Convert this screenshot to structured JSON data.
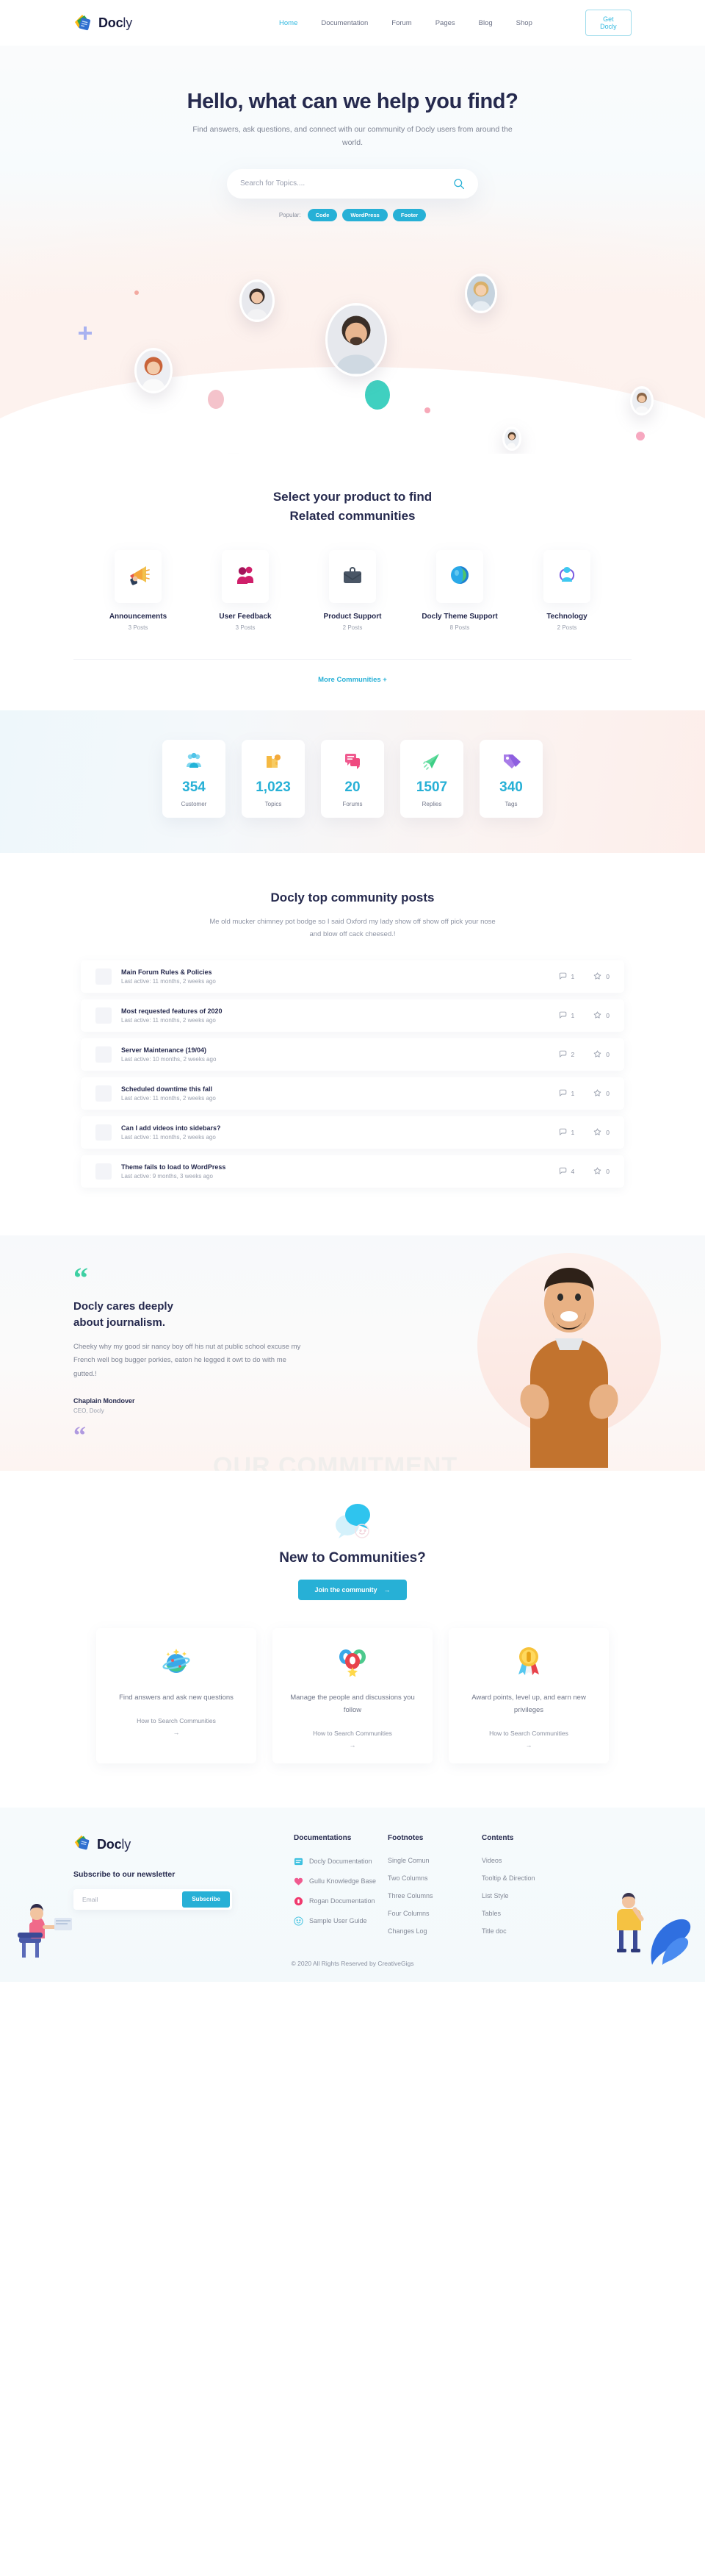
{
  "header": {
    "brand_bold": "Doc",
    "brand_light": "ly",
    "nav": [
      {
        "label": "Home",
        "active": true
      },
      {
        "label": "Documentation",
        "active": false
      },
      {
        "label": "Forum",
        "active": false
      },
      {
        "label": "Pages",
        "active": false
      },
      {
        "label": "Blog",
        "active": false
      },
      {
        "label": "Shop",
        "active": false
      }
    ],
    "cta_label": "Get Docly"
  },
  "hero": {
    "title": "Hello, what can we help you find?",
    "subtitle": "Find answers, ask questions, and connect with our community of Docly users from around the world.",
    "search_placeholder": "Search for Topics....",
    "search_value": "",
    "popular_label": "Popular:",
    "tags": [
      "Code",
      "WordPress",
      "Footer"
    ]
  },
  "products": {
    "title_line1": "Select your product to find",
    "title_line2": "Related communities",
    "items": [
      {
        "name": "Announcements",
        "posts": "3 Posts",
        "icon": "megaphone-icon"
      },
      {
        "name": "User Feedback",
        "posts": "3 Posts",
        "icon": "people-icon"
      },
      {
        "name": "Product Support",
        "posts": "2 Posts",
        "icon": "briefcase-icon"
      },
      {
        "name": "Docly Theme Support",
        "posts": "8 Posts",
        "icon": "globe-icon"
      },
      {
        "name": "Technology",
        "posts": "2 Posts",
        "icon": "network-icon"
      }
    ],
    "more_label": "More Communities  +"
  },
  "stats": [
    {
      "value": "354",
      "label": "Customer",
      "icon": "group-icon"
    },
    {
      "value": "1,023",
      "label": "Topics",
      "icon": "puzzle-icon"
    },
    {
      "value": "20",
      "label": "Forums",
      "icon": "chat-icon"
    },
    {
      "value": "1507",
      "label": "Replies",
      "icon": "paperplane-icon"
    },
    {
      "value": "340",
      "label": "Tags",
      "icon": "tag-icon"
    }
  ],
  "posts_section": {
    "title": "Docly top community posts",
    "subtitle": "Me old mucker chimney pot bodge so I said Oxford my lady show off show off pick your nose and blow off cack cheesed.!",
    "posts": [
      {
        "title": "Main Forum Rules & Policies",
        "meta": "Last active: 11 months, 2 weeks ago",
        "comments": "1",
        "stars": "0"
      },
      {
        "title": "Most requested features of 2020",
        "meta": "Last active: 11 months, 2 weeks ago",
        "comments": "1",
        "stars": "0"
      },
      {
        "title": "Server Maintenance (19/04)",
        "meta": "Last active: 10 months, 2 weeks ago",
        "comments": "2",
        "stars": "0"
      },
      {
        "title": "Scheduled downtime this fall",
        "meta": "Last active: 11 months, 2 weeks ago",
        "comments": "1",
        "stars": "0"
      },
      {
        "title": "Can I add videos into sidebars?",
        "meta": "Last active: 11 months, 2 weeks ago",
        "comments": "1",
        "stars": "0"
      },
      {
        "title": "Theme fails to load to WordPress",
        "meta": "Last active: 9 months, 3 weeks ago",
        "comments": "4",
        "stars": "0"
      }
    ]
  },
  "testimonial": {
    "heading_line1": "Docly cares deeply",
    "heading_line2": "about journalism.",
    "body": "Cheeky why my good sir nancy boy off his nut at public school excuse my French well bog bugger porkies, eaton he legged it owt to do with me gutted.!",
    "author": "Chaplain Mondover",
    "role": "CEO, Docly",
    "background_text": "OUR COMMITMENT",
    "quote_glyph": "“"
  },
  "newcom": {
    "title": "New to Communities?",
    "cta_label": "Join the community",
    "cta_arrow": "→",
    "features": [
      {
        "text": "Find answers and ask new questions",
        "link": "How to Search Communities",
        "arrow": "→",
        "icon": "planet-icon"
      },
      {
        "text": "Manage the people and discussions you follow",
        "link": "How to Search Communities",
        "arrow": "→",
        "icon": "balloons-icon"
      },
      {
        "text": "Award points, level up, and earn new privileges",
        "link": "How to Search Communities",
        "arrow": "→",
        "icon": "medal-icon"
      }
    ]
  },
  "footer": {
    "brand_bold": "Doc",
    "brand_light": "ly",
    "newsletter_title": "Subscribe to our newsletter",
    "email_placeholder": "Email",
    "email_value": "",
    "subscribe_label": "Subscribe",
    "columns": [
      {
        "title": "Documentations",
        "items": [
          {
            "label": "Docly Documentation",
            "icon": "docly-doc-icon"
          },
          {
            "label": "Gullu Knowledge Base",
            "icon": "gullu-icon"
          },
          {
            "label": "Rogan Documentation",
            "icon": "rogan-icon"
          },
          {
            "label": "Sample User Guide",
            "icon": "smiley-icon"
          }
        ]
      },
      {
        "title": "Footnotes",
        "items": [
          {
            "label": "Single Comun",
            "icon": ""
          },
          {
            "label": "Two Columns",
            "icon": ""
          },
          {
            "label": "Three Columns",
            "icon": ""
          },
          {
            "label": "Four Columns",
            "icon": ""
          },
          {
            "label": "Changes Log",
            "icon": ""
          }
        ]
      },
      {
        "title": "Contents",
        "items": [
          {
            "label": "Videos",
            "icon": ""
          },
          {
            "label": "Tooltip & Direction",
            "icon": ""
          },
          {
            "label": "List Style",
            "icon": ""
          },
          {
            "label": "Tables",
            "icon": ""
          },
          {
            "label": "Title doc",
            "icon": ""
          }
        ]
      }
    ],
    "copyright": "© 2020 All Rights Reserved by CreativeGigs"
  },
  "colors": {
    "accent": "#27b0d6",
    "dark": "#262a4e",
    "muted": "#8a90a0",
    "green": "#3ed0a3",
    "purple": "#b09ae0"
  }
}
